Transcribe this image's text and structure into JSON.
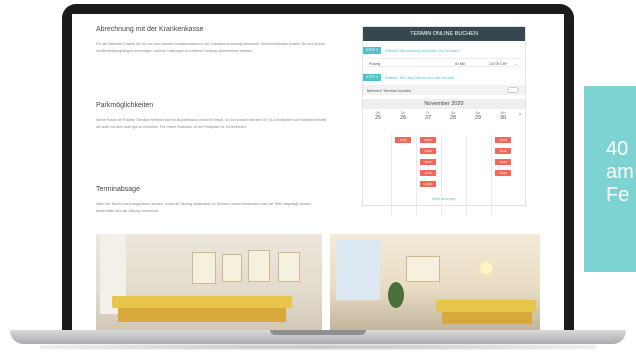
{
  "promo": {
    "line1": "40",
    "line2": "am",
    "line3": "Fe"
  },
  "content": {
    "billing": {
      "heading": "Abrechnung mit der Krankenkasse",
      "text": "Für die Methode Polarity bin ich von den meisten Krankenkassen in der Zusatzversicherung anerkannt. Sicherheitshalber sollten Sie sich jedoch vor Behandlungsbeginn erkundigen, welche Leistungen in welchem Umfang übernommen werden."
    },
    "parking": {
      "heading": "Parkmöglichkeiten",
      "text": "Meine Praxis für Polarity Therapie befindet sich im Buchtelhaus zentral in Hinwil. Ich bin sowohl mit dem ÖV (5 Gehminuten vom Bahnhof Hinwil) als auch mit dem Auto gut zu erreichen. Für meine Besucher ist der Parkplatz Nr. 53 reserviert."
    },
    "cancellation": {
      "heading": "Terminabsage",
      "text": "Kann ein Termin nicht eingehalten werden, muss die Sitzung spätestens 24 Stunden vorher telefonisch oder per SMS abgesagt werden. Andernfalls wird die Sitzung verrechnet."
    }
  },
  "widget": {
    "title": "TERMIN ONLINE BUCHEN",
    "step1_badge": "STEP 1",
    "step1_question": "Welche Behandlung möchten Sie buchen?",
    "service": {
      "name": "Polarity",
      "duration": "60 Min",
      "price": "120,00 CHF"
    },
    "step2_badge": "STEP 2",
    "step2_question": "Wählen Sie das Datum und die Uhrzeit",
    "multi_label": "Mehrere Termine buchen",
    "month": "November 2020",
    "days": [
      {
        "name": "Mi",
        "date": "25",
        "slots": []
      },
      {
        "name": "Do",
        "date": "26",
        "slots": [
          "11:00"
        ]
      },
      {
        "name": "Fr",
        "date": "27",
        "slots": [
          "08:00",
          "09:00",
          "10:00",
          "11:00",
          "12:00"
        ]
      },
      {
        "name": "Sa",
        "date": "28",
        "slots": []
      },
      {
        "name": "So",
        "date": "29",
        "slots": []
      },
      {
        "name": "Mo",
        "date": "30",
        "slots": [
          "10:00",
          "11:00",
          "12:00",
          "13:00"
        ]
      }
    ],
    "more_label": "Mehr anzeigen"
  },
  "colors": {
    "accent": "#4fc3c9",
    "slot": "#f06a5a",
    "header": "#37474f",
    "promo": "#7cd3d1"
  }
}
